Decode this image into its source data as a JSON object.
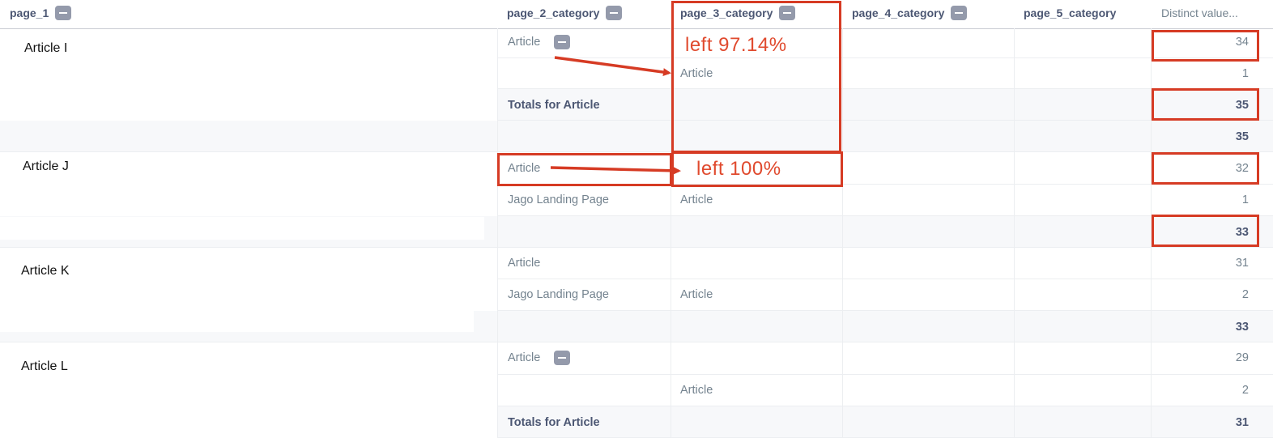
{
  "header": {
    "columns": [
      {
        "label": "page_1",
        "collapsible": true
      },
      {
        "label": "page_2_category",
        "collapsible": true
      },
      {
        "label": "page_3_category",
        "collapsible": true
      },
      {
        "label": "page_4_category",
        "collapsible": true
      },
      {
        "label": "page_5_category",
        "collapsible": false
      },
      {
        "label": "Distinct value...",
        "collapsible": false
      }
    ]
  },
  "groups": [
    {
      "page_1": "Article I",
      "rows": [
        {
          "page_2": "Article",
          "page_3": "",
          "value": "34",
          "collapsible": true
        },
        {
          "page_2": "",
          "page_3": "Article",
          "value": "1"
        },
        {
          "page_2": "Totals for Article",
          "value": "35",
          "total": true
        }
      ],
      "group_total": "35"
    },
    {
      "page_1": "Article J",
      "rows": [
        {
          "page_2": "Article",
          "page_3": "",
          "value": "32"
        },
        {
          "page_2": "Jago Landing Page",
          "page_3": "Article",
          "value": "1"
        }
      ],
      "group_total": "33"
    },
    {
      "page_1": "Article K",
      "rows": [
        {
          "page_2": "Article",
          "page_3": "",
          "value": "31"
        },
        {
          "page_2": "Jago Landing Page",
          "page_3": "Article",
          "value": "2"
        }
      ],
      "group_total": "33"
    },
    {
      "page_1": "Article L",
      "rows": [
        {
          "page_2": "Article",
          "page_3": "",
          "value": "29",
          "collapsible": true
        },
        {
          "page_2": "",
          "page_3": "Article",
          "value": "2"
        },
        {
          "page_2": "Totals for Article",
          "value": "31",
          "total": true
        }
      ]
    }
  ],
  "annotations": {
    "left_1": "left  97.14%",
    "left_2": "left  100%",
    "color": "#d63b24"
  }
}
